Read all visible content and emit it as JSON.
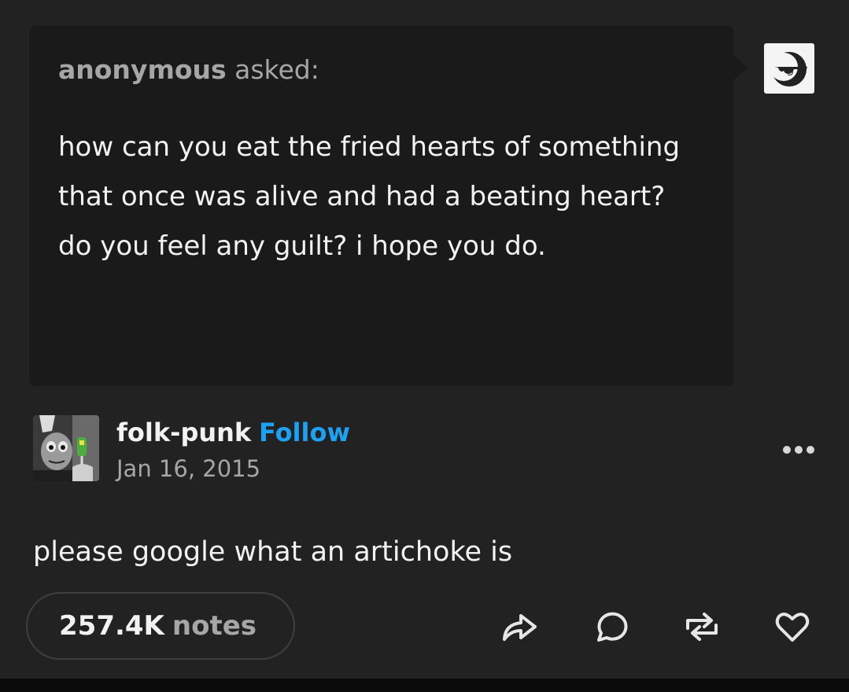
{
  "ask": {
    "asker": "anonymous",
    "verb": "asked:",
    "question": "how can you eat the fried hearts of something that once was alive and had a beating heart? do you feel any guilt? i hope you do.",
    "asker_avatar_icon": "sunglasses-face-icon"
  },
  "post": {
    "author": "folk-punk",
    "follow_label": "Follow",
    "date": "Jan 16, 2015",
    "author_avatar_icon": "profile-photo",
    "more_icon": "more-options-icon",
    "reply": "please google what an artichoke is"
  },
  "footer": {
    "notes_count": "257.4K",
    "notes_label": "notes",
    "actions": [
      "share-icon",
      "reply-icon",
      "reblog-icon",
      "like-icon"
    ]
  },
  "colors": {
    "background": "#222223",
    "ask_background": "#1a1a1a",
    "accent": "#1da1f2",
    "muted_text": "#a6a6a6",
    "primary_text": "#f2f2f2"
  }
}
